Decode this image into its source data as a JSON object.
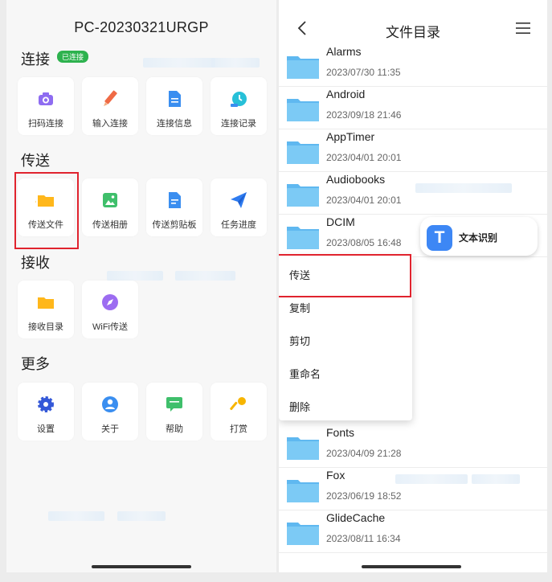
{
  "left": {
    "pc_name": "PC-20230321URGP",
    "connect": {
      "title": "连接",
      "badge": "已连接",
      "items": [
        {
          "label": "扫码连接",
          "icon": "camera-icon"
        },
        {
          "label": "输入连接",
          "icon": "pencil-icon"
        },
        {
          "label": "连接信息",
          "icon": "document-icon"
        },
        {
          "label": "连接记录",
          "icon": "clock-icon"
        }
      ]
    },
    "send": {
      "title": "传送",
      "items": [
        {
          "label": "传送文件",
          "icon": "folder-icon"
        },
        {
          "label": "传送相册",
          "icon": "image-icon"
        },
        {
          "label": "传送剪贴板",
          "icon": "clipboard-icon"
        },
        {
          "label": "任务进度",
          "icon": "paper-plane-icon"
        }
      ]
    },
    "receive": {
      "title": "接收",
      "items": [
        {
          "label": "接收目录",
          "icon": "folder-icon"
        },
        {
          "label": "WiFi传送",
          "icon": "compass-icon"
        }
      ]
    },
    "more": {
      "title": "更多",
      "items": [
        {
          "label": "设置",
          "icon": "gear-icon"
        },
        {
          "label": "关于",
          "icon": "user-icon"
        },
        {
          "label": "帮助",
          "icon": "chat-bubble-icon"
        },
        {
          "label": "打赏",
          "icon": "key-icon"
        }
      ]
    }
  },
  "right": {
    "title": "文件目录",
    "files": [
      {
        "name": "Alarms",
        "date": "2023/07/30 11:35"
      },
      {
        "name": "Android",
        "date": "2023/09/18 21:46"
      },
      {
        "name": "AppTimer",
        "date": "2023/04/01 20:01"
      },
      {
        "name": "Audiobooks",
        "date": "2023/04/01 20:01"
      },
      {
        "name": "DCIM",
        "date": "2023/08/05 16:48"
      },
      {
        "name": "Fonts",
        "date": "2023/04/09 21:28"
      },
      {
        "name": "Fox",
        "date": "2023/06/19 18:52"
      },
      {
        "name": "GlideCache",
        "date": "2023/08/11 16:34"
      }
    ],
    "ocr_label": "文本识别",
    "context_menu": [
      "传送",
      "复制",
      "剪切",
      "重命名",
      "删除"
    ]
  },
  "colors": {
    "accent_blue": "#3d87f5",
    "folder_blue": "#5fb8f0",
    "highlight_red": "#e0232e",
    "connected_green": "#2db24e"
  }
}
